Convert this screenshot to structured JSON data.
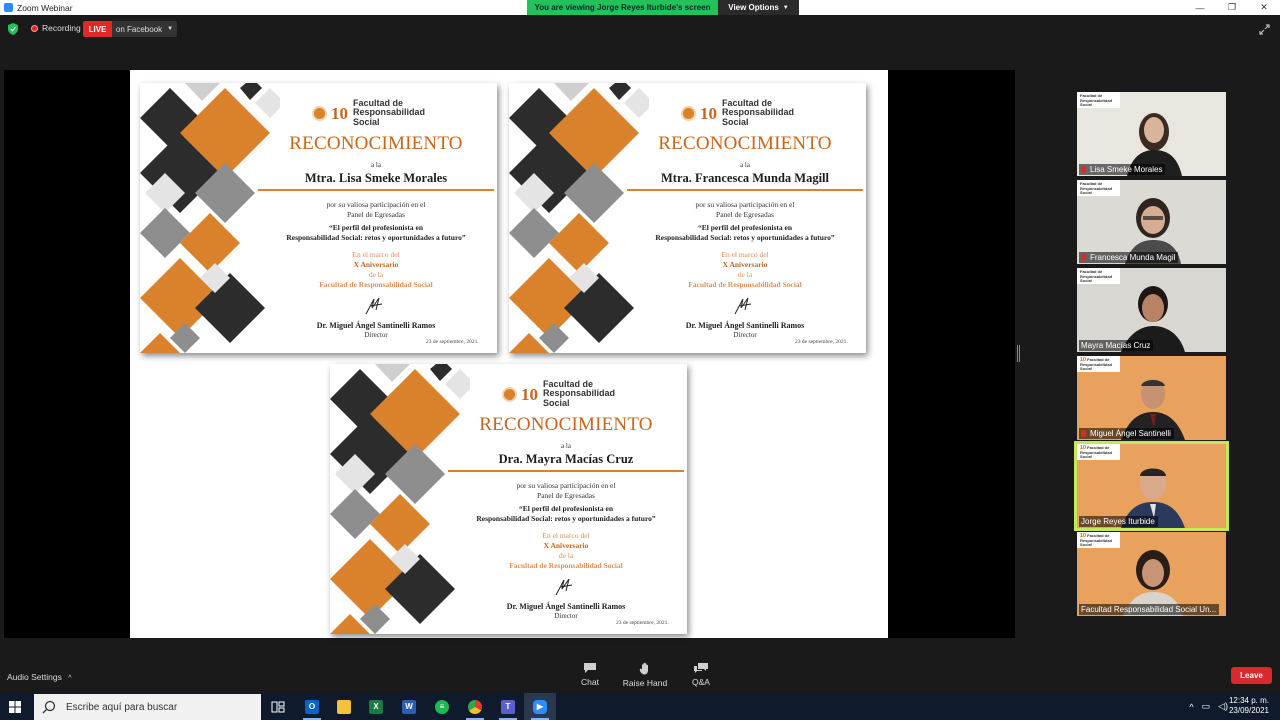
{
  "window": {
    "title": "Zoom Webinar",
    "controls": [
      "—",
      "❐",
      "✕"
    ]
  },
  "share_banner": {
    "text": "You are viewing Jorge Reyes Iturbide's screen",
    "view_options": "View Options"
  },
  "meeting_bar": {
    "recording": "Recording",
    "live": "LIVE",
    "live_destination": "on Facebook"
  },
  "certificates": [
    {
      "logo_number": "10",
      "logo_text": "Facultad de Responsabilidad Social",
      "heading": "RECONOCIMIENTO",
      "to": "a la",
      "name": "Mtra. Lisa Smeke Morales",
      "line1": "por su valiosa participación en el",
      "line2": "Panel de Egresadas",
      "quote1": "“El perfil del profesionista en",
      "quote2": "Responsabilidad Social: retos y oportunidades a futuro”",
      "context1": "En el marco del",
      "context2": "X Aniversario",
      "context3": "de la",
      "context4": "Facultad de Responsabilidad Social",
      "director": "Dr. Miguel Ángel Santinelli Ramos",
      "director_title": "Director",
      "date": "23 de septiembre, 2021."
    },
    {
      "logo_number": "10",
      "logo_text": "Facultad de Responsabilidad Social",
      "heading": "RECONOCIMIENTO",
      "to": "a la",
      "name": "Mtra. Francesca Munda Magill",
      "line1": "por su valiosa participación en el",
      "line2": "Panel de Egresadas",
      "quote1": "“El perfil del profesionista en",
      "quote2": "Responsabilidad Social: retos y oportunidades a futuro”",
      "context1": "En el marco del",
      "context2": "X Aniversario",
      "context3": "de la",
      "context4": "Facultad de Responsabilidad Social",
      "director": "Dr. Miguel Ángel Santinelli Ramos",
      "director_title": "Director",
      "date": "23 de septiembre, 2021."
    },
    {
      "logo_number": "10",
      "logo_text": "Facultad de Responsabilidad Social",
      "heading": "RECONOCIMIENTO",
      "to": "a la",
      "name": "Dra. Mayra Macías Cruz",
      "line1": "por su valiosa participación en el",
      "line2": "Panel de Egresadas",
      "quote1": "“El perfil del profesionista en",
      "quote2": "Responsabilidad Social: retos y oportunidades a futuro”",
      "context1": "En el marco del",
      "context2": "X Aniversario",
      "context3": "de la",
      "context4": "Facultad de Responsabilidad Social",
      "director": "Dr. Miguel Ángel Santinelli Ramos",
      "director_title": "Director",
      "date": "23 de septiembre, 2021."
    }
  ],
  "participants": [
    {
      "name": "Lisa Smeke Morales"
    },
    {
      "name": "Francesca Munda Magil"
    },
    {
      "name": "Mayra Macías Cruz"
    },
    {
      "name": "Miguel Ángel Santinelli"
    },
    {
      "name": "Jorge Reyes Iturbide",
      "active_speaker": true
    },
    {
      "name": "Facultad Responsabilidad Social Un..."
    }
  ],
  "tile_banner": {
    "number": "10",
    "text": "Facultad de Responsabilidad Social"
  },
  "toolbar": {
    "audio_settings": "Audio Settings",
    "chat": "Chat",
    "raise_hand": "Raise Hand",
    "qa": "Q&A",
    "leave": "Leave"
  },
  "taskbar": {
    "search_placeholder": "Escribe aquí para buscar",
    "time": "12:34 p. m.",
    "date": "23/09/2021",
    "apps": [
      "task-view",
      "outlook",
      "file-explorer",
      "excel",
      "word",
      "spotify",
      "chrome",
      "teams",
      "zoom"
    ]
  },
  "colors": {
    "accent_orange": "#d9822b",
    "live_red": "#e02828",
    "share_green": "#23c15a",
    "leave_red": "#d9292c",
    "active_outline": "#c5e85b"
  }
}
